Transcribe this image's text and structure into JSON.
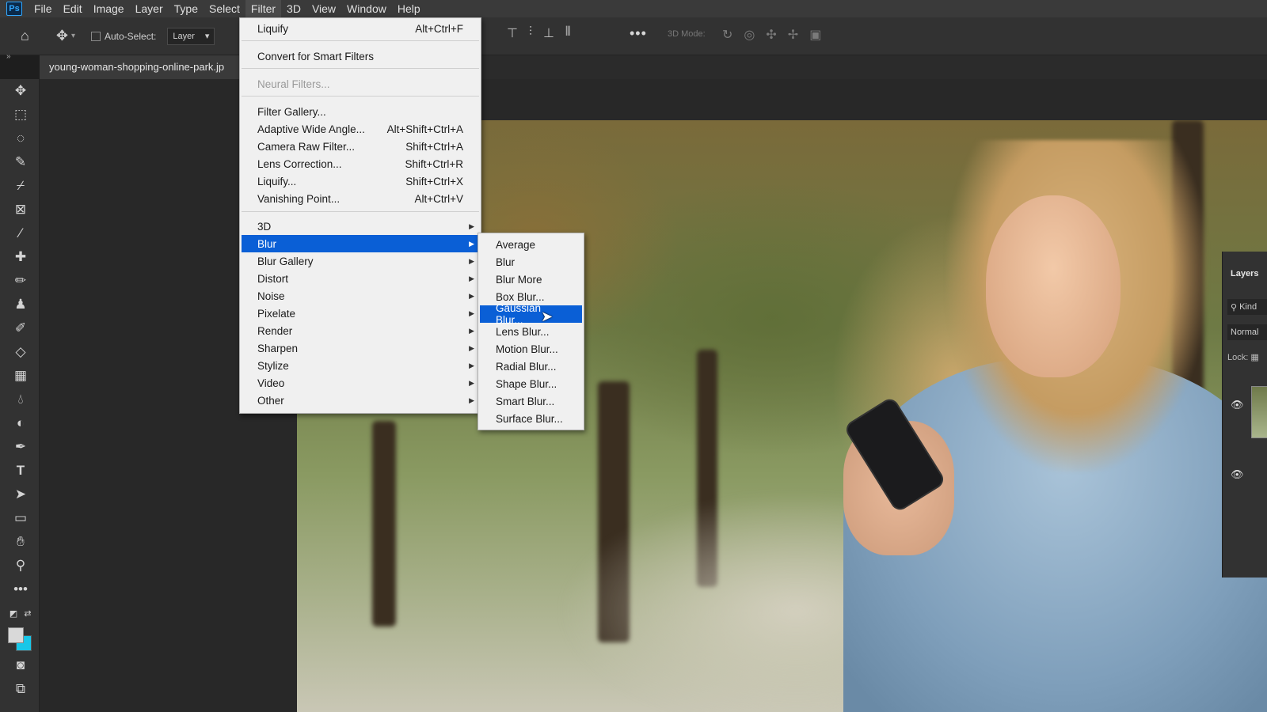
{
  "app": {
    "logo": "Ps",
    "menu": [
      "File",
      "Edit",
      "Image",
      "Layer",
      "Type",
      "Select",
      "Filter",
      "3D",
      "View",
      "Window",
      "Help"
    ],
    "active_menu": "Filter"
  },
  "options": {
    "auto_select_label": "Auto-Select:",
    "layer_select_value": "Layer",
    "mode_3d_label": "3D Mode:"
  },
  "document": {
    "tab_title": "young-woman-shopping-online-park.jp"
  },
  "filter_menu": {
    "items": [
      {
        "label": "Liquify",
        "shortcut": "Alt+Ctrl+F"
      },
      {
        "label": "Convert for Smart Filters",
        "shortcut": ""
      },
      {
        "label": "Neural Filters...",
        "shortcut": "",
        "disabled": true
      },
      {
        "label": "Filter Gallery...",
        "shortcut": ""
      },
      {
        "label": "Adaptive Wide Angle...",
        "shortcut": "Alt+Shift+Ctrl+A"
      },
      {
        "label": "Camera Raw Filter...",
        "shortcut": "Shift+Ctrl+A"
      },
      {
        "label": "Lens Correction...",
        "shortcut": "Shift+Ctrl+R"
      },
      {
        "label": "Liquify...",
        "shortcut": "Shift+Ctrl+X"
      },
      {
        "label": "Vanishing Point...",
        "shortcut": "Alt+Ctrl+V"
      },
      {
        "label": "3D",
        "submenu": true
      },
      {
        "label": "Blur",
        "submenu": true,
        "highlighted": true
      },
      {
        "label": "Blur Gallery",
        "submenu": true
      },
      {
        "label": "Distort",
        "submenu": true
      },
      {
        "label": "Noise",
        "submenu": true
      },
      {
        "label": "Pixelate",
        "submenu": true
      },
      {
        "label": "Render",
        "submenu": true
      },
      {
        "label": "Sharpen",
        "submenu": true
      },
      {
        "label": "Stylize",
        "submenu": true
      },
      {
        "label": "Video",
        "submenu": true
      },
      {
        "label": "Other",
        "submenu": true
      }
    ]
  },
  "blur_menu": {
    "items": [
      {
        "label": "Average"
      },
      {
        "label": "Blur"
      },
      {
        "label": "Blur More"
      },
      {
        "label": "Box Blur..."
      },
      {
        "label": "Gaussian Blur...",
        "highlighted": true
      },
      {
        "label": "Lens Blur..."
      },
      {
        "label": "Motion Blur..."
      },
      {
        "label": "Radial Blur..."
      },
      {
        "label": "Shape Blur..."
      },
      {
        "label": "Smart Blur..."
      },
      {
        "label": "Surface Blur..."
      }
    ]
  },
  "layers_panel": {
    "title": "Layers",
    "kind_label": "Kind",
    "blend_mode": "Normal",
    "lock_label": "Lock:"
  },
  "colors": {
    "highlight": "#0a5fd6",
    "background_swatch": "#19c7e8",
    "foreground_swatch": "#d9d9d9"
  }
}
